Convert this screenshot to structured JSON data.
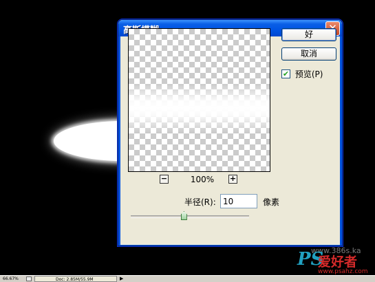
{
  "dialog": {
    "title": "高斯模糊",
    "close_glyph": "✕",
    "ok_label": "好",
    "cancel_label": "取消",
    "preview_checkbox": {
      "label": "预览(P)",
      "checked": true,
      "check_glyph": "✔"
    },
    "zoom": {
      "minus": "−",
      "plus": "+",
      "level": "100%"
    },
    "radius": {
      "label": "半径(R):",
      "value": "10",
      "unit": "像素",
      "slider_fraction": 0.45
    }
  },
  "statusbar": {
    "zoom": "66.67%",
    "doc": "Doc: 2.85M/55.9M",
    "arrow": "▶"
  },
  "watermark": {
    "brand": "PS",
    "cn": "爱好者",
    "url": "www.psahz.com",
    "site": "www.386s.ka"
  },
  "colors": {
    "titlebar": "#0054e3",
    "dialog_bg": "#ece9d8",
    "canvas_bg": "#000000"
  }
}
